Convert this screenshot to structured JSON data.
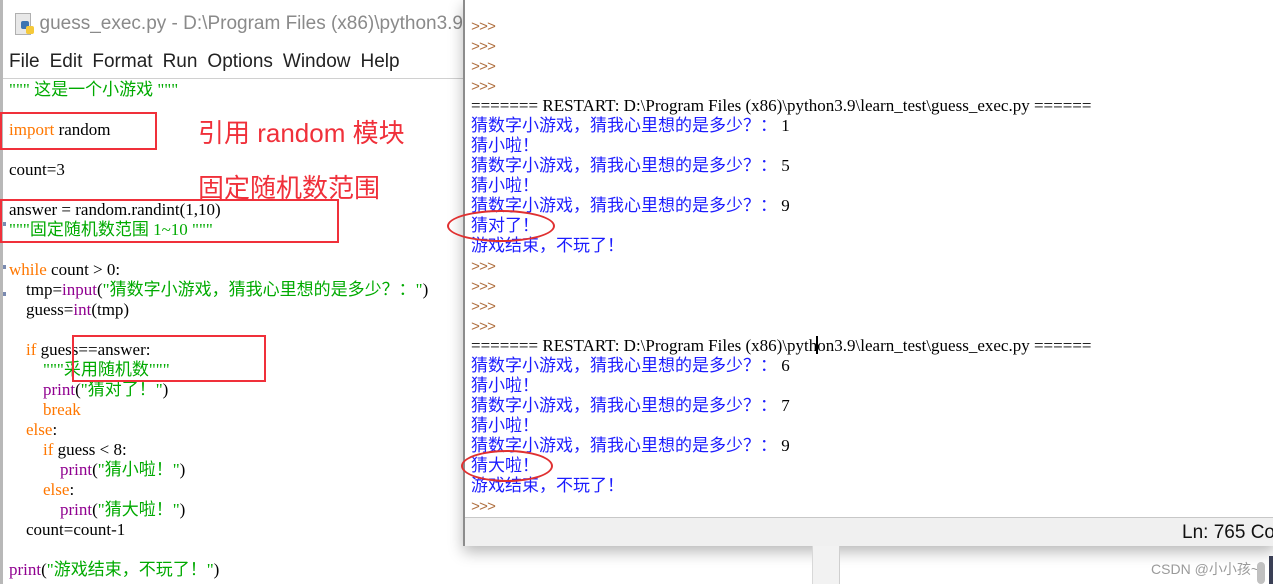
{
  "editor": {
    "title": "guess_exec.py - D:\\Program Files (x86)\\python3.9",
    "icon": "python-file-icon",
    "menu": [
      "File",
      "Edit",
      "Format",
      "Run",
      "Options",
      "Window",
      "Help"
    ],
    "code": [
      {
        "segments": [
          {
            "t": "\"\"\" 这是一个小游戏 \"\"\"",
            "c": "str"
          }
        ]
      },
      {
        "segments": []
      },
      {
        "segments": [
          {
            "t": "import",
            "c": "kw"
          },
          {
            "t": " random",
            "c": ""
          }
        ]
      },
      {
        "segments": []
      },
      {
        "segments": [
          {
            "t": "count=3",
            "c": ""
          }
        ]
      },
      {
        "segments": []
      },
      {
        "segments": [
          {
            "t": "answer = random.randint(1,10)",
            "c": ""
          }
        ]
      },
      {
        "segments": [
          {
            "t": "\"\"\"固定随机数范围 1~10 \"\"\"",
            "c": "str"
          }
        ]
      },
      {
        "segments": []
      },
      {
        "segments": [
          {
            "t": "while",
            "c": "kw"
          },
          {
            "t": " count > 0:",
            "c": ""
          }
        ]
      },
      {
        "segments": [
          {
            "t": "    tmp=",
            "c": ""
          },
          {
            "t": "input",
            "c": "bi"
          },
          {
            "t": "(",
            "c": ""
          },
          {
            "t": "\"猜数字小游戏，猜我心里想的是多少？：\"",
            "c": "str"
          },
          {
            "t": ")",
            "c": ""
          }
        ]
      },
      {
        "segments": [
          {
            "t": "    guess=",
            "c": ""
          },
          {
            "t": "int",
            "c": "bi"
          },
          {
            "t": "(tmp)",
            "c": ""
          }
        ]
      },
      {
        "segments": []
      },
      {
        "segments": [
          {
            "t": "    ",
            "c": ""
          },
          {
            "t": "if",
            "c": "kw"
          },
          {
            "t": " guess==answer:",
            "c": ""
          }
        ]
      },
      {
        "segments": [
          {
            "t": "        ",
            "c": ""
          },
          {
            "t": "\"\"\"采用随机数\"\"\"",
            "c": "str"
          }
        ]
      },
      {
        "segments": [
          {
            "t": "        ",
            "c": ""
          },
          {
            "t": "print",
            "c": "bi"
          },
          {
            "t": "(",
            "c": ""
          },
          {
            "t": "\"猜对了！\"",
            "c": "str"
          },
          {
            "t": ")",
            "c": ""
          }
        ]
      },
      {
        "segments": [
          {
            "t": "        ",
            "c": ""
          },
          {
            "t": "break",
            "c": "kw"
          }
        ]
      },
      {
        "segments": [
          {
            "t": "    ",
            "c": ""
          },
          {
            "t": "else",
            "c": "kw"
          },
          {
            "t": ":",
            "c": ""
          }
        ]
      },
      {
        "segments": [
          {
            "t": "        ",
            "c": ""
          },
          {
            "t": "if",
            "c": "kw"
          },
          {
            "t": " guess < 8:",
            "c": ""
          }
        ]
      },
      {
        "segments": [
          {
            "t": "            ",
            "c": ""
          },
          {
            "t": "print",
            "c": "bi"
          },
          {
            "t": "(",
            "c": ""
          },
          {
            "t": "\"猜小啦！\"",
            "c": "str"
          },
          {
            "t": ")",
            "c": ""
          }
        ]
      },
      {
        "segments": [
          {
            "t": "        ",
            "c": ""
          },
          {
            "t": "else",
            "c": "kw"
          },
          {
            "t": ":",
            "c": ""
          }
        ]
      },
      {
        "segments": [
          {
            "t": "            ",
            "c": ""
          },
          {
            "t": "print",
            "c": "bi"
          },
          {
            "t": "(",
            "c": ""
          },
          {
            "t": "\"猜大啦！\"",
            "c": "str"
          },
          {
            "t": ")",
            "c": ""
          }
        ]
      },
      {
        "segments": [
          {
            "t": "    count=count-1",
            "c": ""
          }
        ]
      },
      {
        "segments": []
      },
      {
        "segments": [
          {
            "t": "print",
            "c": "bi"
          },
          {
            "t": "(",
            "c": ""
          },
          {
            "t": "\"游戏结束，不玩了！\"",
            "c": "str"
          },
          {
            "t": ")",
            "c": ""
          }
        ]
      }
    ],
    "annotations": {
      "import_note": "引用 random 模块",
      "range_note": "固定随机数范围"
    }
  },
  "shell": {
    "lines": [
      {
        "type": "prompt",
        "text": ">>>"
      },
      {
        "type": "prompt",
        "text": ">>>"
      },
      {
        "type": "prompt",
        "text": ">>>"
      },
      {
        "type": "prompt",
        "text": ">>>"
      },
      {
        "type": "restart",
        "text": "======= RESTART: D:\\Program Files (x86)\\python3.9\\learn_test\\guess_exec.py ======"
      },
      {
        "type": "input",
        "text": "猜数字小游戏，猜我心里想的是多少？：",
        "value": " 1"
      },
      {
        "type": "output",
        "text": "猜小啦！"
      },
      {
        "type": "input",
        "text": "猜数字小游戏，猜我心里想的是多少？：",
        "value": " 5"
      },
      {
        "type": "output",
        "text": "猜小啦！"
      },
      {
        "type": "input",
        "text": "猜数字小游戏，猜我心里想的是多少？：",
        "value": " 9"
      },
      {
        "type": "output",
        "text": "猜对了！"
      },
      {
        "type": "output",
        "text": "游戏结束，不玩了！"
      },
      {
        "type": "prompt",
        "text": ">>>"
      },
      {
        "type": "prompt",
        "text": ">>>"
      },
      {
        "type": "prompt",
        "text": ">>>"
      },
      {
        "type": "prompt",
        "text": ">>>"
      },
      {
        "type": "restart",
        "text": "======= RESTART: D:\\Program Files (x86)\\python3.9\\learn_test\\guess_exec.py ======"
      },
      {
        "type": "input",
        "text": "猜数字小游戏，猜我心里想的是多少？：",
        "value": " 6"
      },
      {
        "type": "output",
        "text": "猜小啦！"
      },
      {
        "type": "input",
        "text": "猜数字小游戏，猜我心里想的是多少？：",
        "value": " 7"
      },
      {
        "type": "output",
        "text": "猜小啦！"
      },
      {
        "type": "input",
        "text": "猜数字小游戏，猜我心里想的是多少？：",
        "value": " 9"
      },
      {
        "type": "output",
        "text": "猜大啦！"
      },
      {
        "type": "output",
        "text": "游戏结束，不玩了！"
      },
      {
        "type": "prompt",
        "text": ">>>"
      }
    ],
    "status": "Ln: 765  Co"
  },
  "watermark": "CSDN @小小孩~"
}
